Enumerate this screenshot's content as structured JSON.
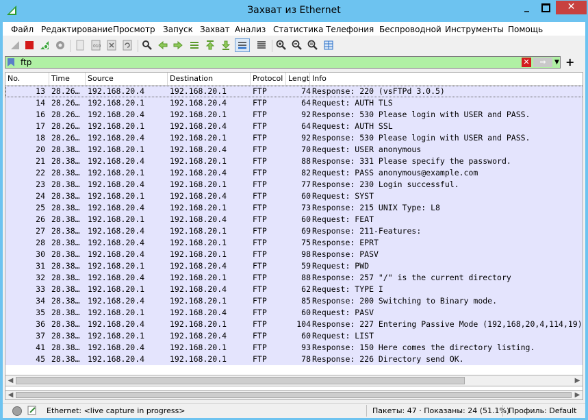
{
  "window": {
    "title": "Захват из Ethernet"
  },
  "menu": [
    "Файл",
    "Редактирование",
    "Просмотр",
    "Запуск",
    "Захват",
    "Анализ",
    "Статистика",
    "Телефония",
    "Беспроводной",
    "Инструменты",
    "Помощь"
  ],
  "filter": {
    "value": "ftp"
  },
  "columns": [
    "No.",
    "Time",
    "Source",
    "Destination",
    "Protocol",
    "Lengt",
    "Info"
  ],
  "packets": [
    {
      "no": "13",
      "time": "28.26…",
      "src": "192.168.20.4",
      "dst": "192.168.20.1",
      "proto": "FTP",
      "len": "74",
      "info": "Response: 220 (vsFTPd 3.0.5)"
    },
    {
      "no": "14",
      "time": "28.26…",
      "src": "192.168.20.1",
      "dst": "192.168.20.4",
      "proto": "FTP",
      "len": "64",
      "info": "Request: AUTH TLS"
    },
    {
      "no": "16",
      "time": "28.26…",
      "src": "192.168.20.4",
      "dst": "192.168.20.1",
      "proto": "FTP",
      "len": "92",
      "info": "Response: 530 Please login with USER and PASS."
    },
    {
      "no": "17",
      "time": "28.26…",
      "src": "192.168.20.1",
      "dst": "192.168.20.4",
      "proto": "FTP",
      "len": "64",
      "info": "Request: AUTH SSL"
    },
    {
      "no": "18",
      "time": "28.26…",
      "src": "192.168.20.4",
      "dst": "192.168.20.1",
      "proto": "FTP",
      "len": "92",
      "info": "Response: 530 Please login with USER and PASS."
    },
    {
      "no": "20",
      "time": "28.38…",
      "src": "192.168.20.1",
      "dst": "192.168.20.4",
      "proto": "FTP",
      "len": "70",
      "info": "Request: USER anonymous"
    },
    {
      "no": "21",
      "time": "28.38…",
      "src": "192.168.20.4",
      "dst": "192.168.20.1",
      "proto": "FTP",
      "len": "88",
      "info": "Response: 331 Please specify the password."
    },
    {
      "no": "22",
      "time": "28.38…",
      "src": "192.168.20.1",
      "dst": "192.168.20.4",
      "proto": "FTP",
      "len": "82",
      "info": "Request: PASS anonymous@example.com"
    },
    {
      "no": "23",
      "time": "28.38…",
      "src": "192.168.20.4",
      "dst": "192.168.20.1",
      "proto": "FTP",
      "len": "77",
      "info": "Response: 230 Login successful."
    },
    {
      "no": "24",
      "time": "28.38…",
      "src": "192.168.20.1",
      "dst": "192.168.20.4",
      "proto": "FTP",
      "len": "60",
      "info": "Request: SYST"
    },
    {
      "no": "25",
      "time": "28.38…",
      "src": "192.168.20.4",
      "dst": "192.168.20.1",
      "proto": "FTP",
      "len": "73",
      "info": "Response: 215 UNIX Type: L8"
    },
    {
      "no": "26",
      "time": "28.38…",
      "src": "192.168.20.1",
      "dst": "192.168.20.4",
      "proto": "FTP",
      "len": "60",
      "info": "Request: FEAT"
    },
    {
      "no": "27",
      "time": "28.38…",
      "src": "192.168.20.4",
      "dst": "192.168.20.1",
      "proto": "FTP",
      "len": "69",
      "info": "Response: 211-Features:"
    },
    {
      "no": "28",
      "time": "28.38…",
      "src": "192.168.20.4",
      "dst": "192.168.20.1",
      "proto": "FTP",
      "len": "75",
      "info": "Response:  EPRT"
    },
    {
      "no": "30",
      "time": "28.38…",
      "src": "192.168.20.4",
      "dst": "192.168.20.1",
      "proto": "FTP",
      "len": "98",
      "info": "Response:  PASV"
    },
    {
      "no": "31",
      "time": "28.38…",
      "src": "192.168.20.1",
      "dst": "192.168.20.4",
      "proto": "FTP",
      "len": "59",
      "info": "Request: PWD"
    },
    {
      "no": "32",
      "time": "28.38…",
      "src": "192.168.20.4",
      "dst": "192.168.20.1",
      "proto": "FTP",
      "len": "88",
      "info": "Response: 257 \"/\" is the current directory"
    },
    {
      "no": "33",
      "time": "28.38…",
      "src": "192.168.20.1",
      "dst": "192.168.20.4",
      "proto": "FTP",
      "len": "62",
      "info": "Request: TYPE I"
    },
    {
      "no": "34",
      "time": "28.38…",
      "src": "192.168.20.4",
      "dst": "192.168.20.1",
      "proto": "FTP",
      "len": "85",
      "info": "Response: 200 Switching to Binary mode."
    },
    {
      "no": "35",
      "time": "28.38…",
      "src": "192.168.20.1",
      "dst": "192.168.20.4",
      "proto": "FTP",
      "len": "60",
      "info": "Request: PASV"
    },
    {
      "no": "36",
      "time": "28.38…",
      "src": "192.168.20.4",
      "dst": "192.168.20.1",
      "proto": "FTP",
      "len": "104",
      "info": "Response: 227 Entering Passive Mode (192,168,20,4,114,19)"
    },
    {
      "no": "37",
      "time": "28.38…",
      "src": "192.168.20.1",
      "dst": "192.168.20.4",
      "proto": "FTP",
      "len": "60",
      "info": "Request: LIST"
    },
    {
      "no": "41",
      "time": "28.38…",
      "src": "192.168.20.4",
      "dst": "192.168.20.1",
      "proto": "FTP",
      "len": "93",
      "info": "Response: 150 Here comes the directory listing."
    },
    {
      "no": "45",
      "time": "28.38…",
      "src": "192.168.20.4",
      "dst": "192.168.20.1",
      "proto": "FTP",
      "len": "78",
      "info": "Response: 226 Directory send OK."
    }
  ],
  "status": {
    "interface": "Ethernet: <live capture in progress>",
    "packets": "Пакеты: 47 · Показаны: 24 (51.1%)",
    "profile": "Профиль: Default"
  },
  "colors": {
    "row_bg": "#e4e4fd",
    "filter_bg": "#b0f0a4",
    "title_bg": "#6dc3f0",
    "close_bg": "#c7413f"
  }
}
